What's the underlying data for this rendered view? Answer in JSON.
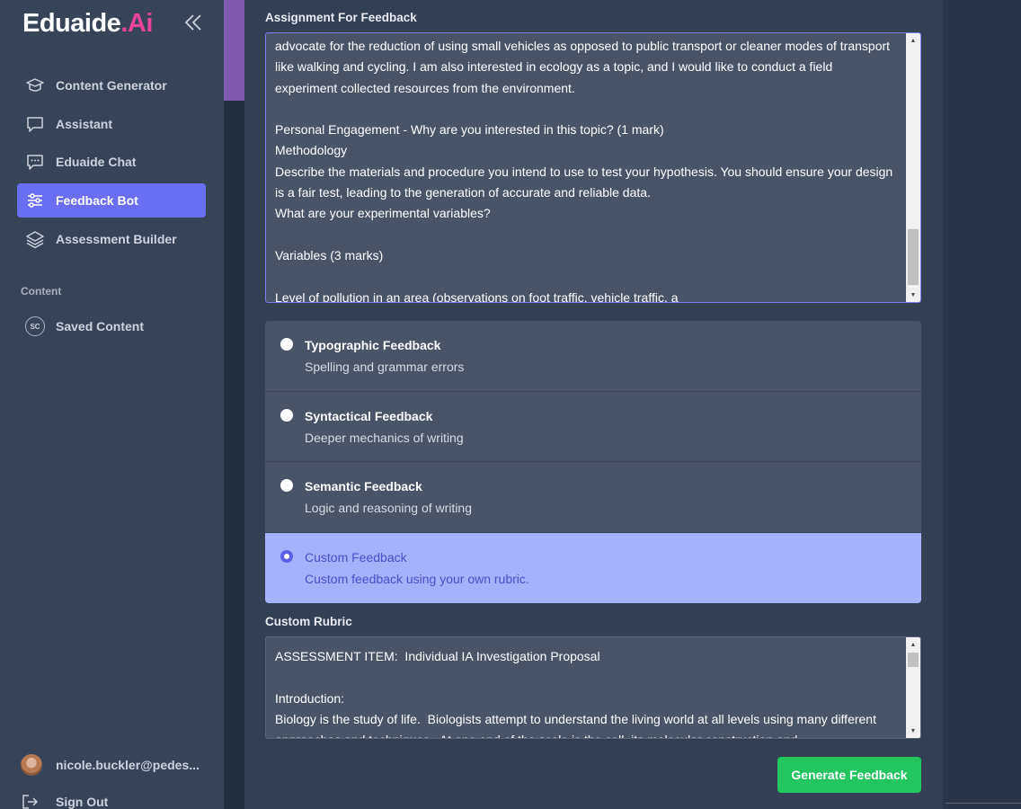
{
  "brand": {
    "name_main": "Eduaide",
    "name_accent": ".Ai"
  },
  "sidebar": {
    "items": [
      {
        "label": "Content Generator",
        "icon": "graduation-cap-icon"
      },
      {
        "label": "Assistant",
        "icon": "chat-bubble-icon"
      },
      {
        "label": "Eduaide Chat",
        "icon": "chat-dots-icon"
      },
      {
        "label": "Feedback Bot",
        "icon": "sliders-icon",
        "active": true
      },
      {
        "label": "Assessment Builder",
        "icon": "layers-icon"
      }
    ],
    "section_label": "Content",
    "saved": {
      "label": "Saved Content",
      "badge": "SC"
    },
    "user": {
      "email": "nicole.buckler@pedes..."
    },
    "signout": {
      "label": "Sign Out"
    }
  },
  "assignment": {
    "label": "Assignment For Feedback",
    "text": "advocate for the reduction of using small vehicles as opposed to public transport or cleaner modes of transport like walking and cycling. I am also interested in ecology as a topic, and I would like to conduct a field experiment collected resources from the environment.\n\nPersonal Engagement - Why are you interested in this topic? (1 mark)\nMethodology\nDescribe the materials and procedure you intend to use to test your hypothesis. You should ensure your design is a fair test, leading to the generation of accurate and reliable data.\nWhat are your experimental variables?\n\nVariables (3 marks)\n\nLevel of pollution in an area (observations on foot traffic, vehicle traffic, a"
  },
  "feedback_options": [
    {
      "title": "Typographic Feedback",
      "desc": "Spelling and grammar errors",
      "selected": false
    },
    {
      "title": "Syntactical Feedback",
      "desc": "Deeper mechanics of writing",
      "selected": false
    },
    {
      "title": "Semantic Feedback",
      "desc": "Logic and reasoning of writing",
      "selected": false
    },
    {
      "title": "Custom Feedback",
      "desc": "Custom feedback using your own rubric.",
      "selected": true
    }
  ],
  "rubric": {
    "label": "Custom Rubric",
    "text": "ASSESSMENT ITEM:  Individual IA Investigation Proposal\n\nIntroduction:\nBiology is the study of life.  Biologists attempt to understand the living world at all levels using many different approaches and techniques.  At one end of the scale is the cell, its molecular construction and"
  },
  "generate_button": {
    "label": "Generate Feedback"
  },
  "colors": {
    "accent": "#6a6ef3",
    "brand_pink": "#e8459a",
    "success": "#22c55e",
    "selected_option": "#a5b1fb"
  }
}
